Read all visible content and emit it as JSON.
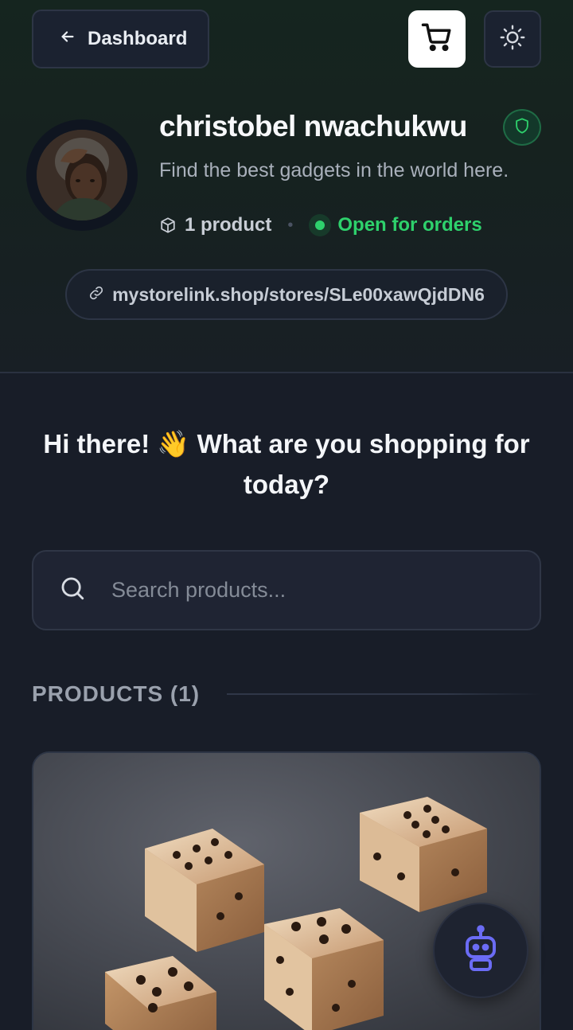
{
  "header": {
    "back_label": "Dashboard",
    "cart_icon": "cart-icon",
    "theme_icon": "sun-icon"
  },
  "store": {
    "name": "christobel nwachukwu",
    "tagline": "Find the best gadgets in the world here.",
    "product_count": "1 product",
    "separator": "•",
    "status": "Open for orders",
    "link": "mystorelink.shop/stores/SLe00xawQjdDN6",
    "status_color": "#2ed16c"
  },
  "main": {
    "greeting": "Hi there! 👋 What are you shopping for today?",
    "search_placeholder": "Search products...",
    "section_title": "PRODUCTS (1)"
  },
  "assistant": {
    "icon": "robot-icon"
  }
}
